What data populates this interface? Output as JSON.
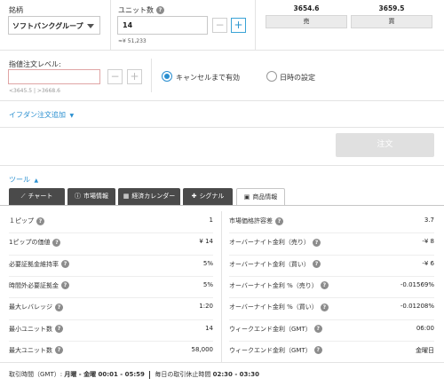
{
  "symbol": {
    "label": "銘柄",
    "value": "ソフトバンクグループ"
  },
  "units": {
    "label": "ユニット数",
    "value": "14",
    "approx": "≈¥ 51,233"
  },
  "quote": {
    "sell_price": "3654.6",
    "buy_price": "3659.5",
    "sell_label": "売",
    "buy_label": "買"
  },
  "limit": {
    "label": "指値注文レベル:",
    "value": "",
    "hint_low": "<3645.5",
    "hint_sep": "|",
    "hint_high": ">3668.6"
  },
  "validity": {
    "option_gtc": "キャンセルまで有効",
    "option_day": "日時の設定"
  },
  "ifdone_link": "イフダン注文追加",
  "order_button": "注文",
  "tools_label": "ツール",
  "tabs": [
    {
      "label": "チャート",
      "icon": "chart-line-icon"
    },
    {
      "label": "市場情報",
      "icon": "info-icon"
    },
    {
      "label": "経済カレンダー",
      "icon": "calendar-icon"
    },
    {
      "label": "シグナル",
      "icon": "puzzle-icon"
    },
    {
      "label": "商品情報",
      "icon": "product-info-icon"
    }
  ],
  "info_left": [
    {
      "key": "１ピップ",
      "value": "1"
    },
    {
      "key": "1ピップの価値",
      "value": "¥ 14"
    },
    {
      "key": "必要証拠金維持率",
      "value": "5%"
    },
    {
      "key": "時間外必要証拠金",
      "value": "5%"
    },
    {
      "key": "最大レバレッジ",
      "value": "1:20"
    },
    {
      "key": "最小ユニット数",
      "value": "14"
    },
    {
      "key": "最大ユニット数",
      "value": "58,000"
    }
  ],
  "info_right": [
    {
      "key": "市場価格許容差",
      "value": "3.7"
    },
    {
      "key": "オーバーナイト金利（売り）",
      "value": "-¥ 8"
    },
    {
      "key": "オーバーナイト金利（買い）",
      "value": "-¥ 6"
    },
    {
      "key": "オーバーナイト金利 %（売り）",
      "value": "-0.01569%"
    },
    {
      "key": "オーバーナイト金利 %（買い）",
      "value": "-0.01208%"
    },
    {
      "key": "ウィークエンド金利（GMT）",
      "value": "06:00"
    },
    {
      "key": "ウィークエンド金利（GMT）",
      "value": "金曜日"
    }
  ],
  "footer": {
    "hours_label": "取引時間（GMT）:",
    "hours_value": "月曜 - 金曜 00:01 - 05:59",
    "break_label": "毎日の取引休止時間",
    "break_value": "02:30 - 03:30"
  }
}
